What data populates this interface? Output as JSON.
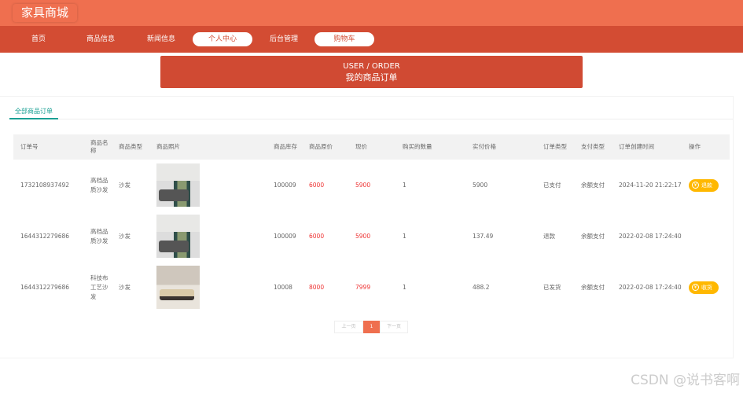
{
  "header": {
    "logo": "家具商城"
  },
  "nav": {
    "items": [
      {
        "label": "首页"
      },
      {
        "label": "商品信息"
      },
      {
        "label": "新闻信息"
      },
      {
        "label": "个人中心"
      },
      {
        "label": "后台管理"
      },
      {
        "label": "购物车"
      }
    ]
  },
  "banner": {
    "title": "USER / ORDER",
    "subtitle": "我的商品订单"
  },
  "tabs": [
    {
      "label": "全部商品订单"
    }
  ],
  "table": {
    "columns": [
      "订单号",
      "商品名称",
      "商品类型",
      "商品照片",
      "商品库存",
      "商品原价",
      "现价",
      "购买的数量",
      "实付价格",
      "订单类型",
      "支付类型",
      "订单创建时间",
      "操作"
    ],
    "rows": [
      {
        "order_no": "1732108937492",
        "name": "高档品质沙发",
        "type": "沙发",
        "stock": "100009",
        "orig": "6000",
        "price": "5900",
        "qty": "1",
        "paid": "5900",
        "status": "已支付",
        "pay": "余额支付",
        "time": "2024-11-20 21:22:17",
        "action": "退款"
      },
      {
        "order_no": "1644312279686",
        "name": "高档品质沙发",
        "type": "沙发",
        "stock": "100009",
        "orig": "6000",
        "price": "5900",
        "qty": "1",
        "paid": "137.49",
        "status": "退款",
        "pay": "余额支付",
        "time": "2022-02-08 17:24:40",
        "action": ""
      },
      {
        "order_no": "1644312279686",
        "name": "科技布工艺沙发",
        "type": "沙发",
        "stock": "10008",
        "orig": "8000",
        "price": "7999",
        "qty": "1",
        "paid": "488.2",
        "status": "已发货",
        "pay": "余额支付",
        "time": "2022-02-08 17:24:40",
        "action": "收货"
      }
    ]
  },
  "pagination": {
    "prev": "上一页",
    "current": "1",
    "next": "下一页"
  },
  "watermark": "CSDN @说书客啊",
  "colors": {
    "header": "#ef6f4f",
    "nav": "#d34c33",
    "accent_tab": "#1aa094",
    "price": "#ee3333",
    "action_button": "#ffb800"
  }
}
